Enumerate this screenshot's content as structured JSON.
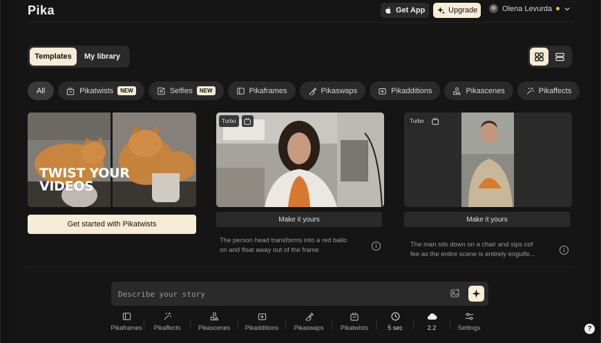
{
  "header": {
    "logo": "Pika",
    "get_app": "Get App",
    "upgrade": "Upgrade",
    "user_name": "Olena Levurda"
  },
  "tabs": {
    "templates": "Templates",
    "library": "My library"
  },
  "chips": [
    {
      "label": "All"
    },
    {
      "label": "Pikatwists",
      "badge": "NEW"
    },
    {
      "label": "Selfies",
      "badge": "NEW"
    },
    {
      "label": "Pikaframes"
    },
    {
      "label": "Pikaswaps"
    },
    {
      "label": "Pikadditions"
    },
    {
      "label": "Pikascenes"
    },
    {
      "label": "Pikaffects"
    }
  ],
  "cards": [
    {
      "overlay_text_1": "TWIST YOUR",
      "overlay_text_2": "VIDEOS",
      "cta": "Get started with Pikatwists"
    },
    {
      "tag": "Turbo",
      "button": "Make it yours",
      "desc_line1": "The person head transforms into a red ballo",
      "desc_line2": "on and float away out of the frame"
    },
    {
      "tag": "Turbo",
      "button": "Make it yours",
      "desc_line1": "The man sits down on a chair and sips cof",
      "desc_line2": "fee as the entire scene is entirely engulfe..."
    }
  ],
  "prompt": {
    "placeholder": "Describe your story"
  },
  "toolbar": [
    {
      "label": "Pikaframes"
    },
    {
      "label": "Pikaffects"
    },
    {
      "label": "Pikascenes"
    },
    {
      "label": "Pikadditions"
    },
    {
      "label": "Pikaswaps"
    },
    {
      "label": "Pikatwists"
    },
    {
      "label": "5 sec"
    },
    {
      "label": "2.2"
    },
    {
      "label": "Settings"
    }
  ],
  "help": "?",
  "colors": {
    "accent": "#f7ecd6",
    "background": "#151515",
    "surface": "#2a2a2a",
    "user_dot": "#f2c14e"
  }
}
